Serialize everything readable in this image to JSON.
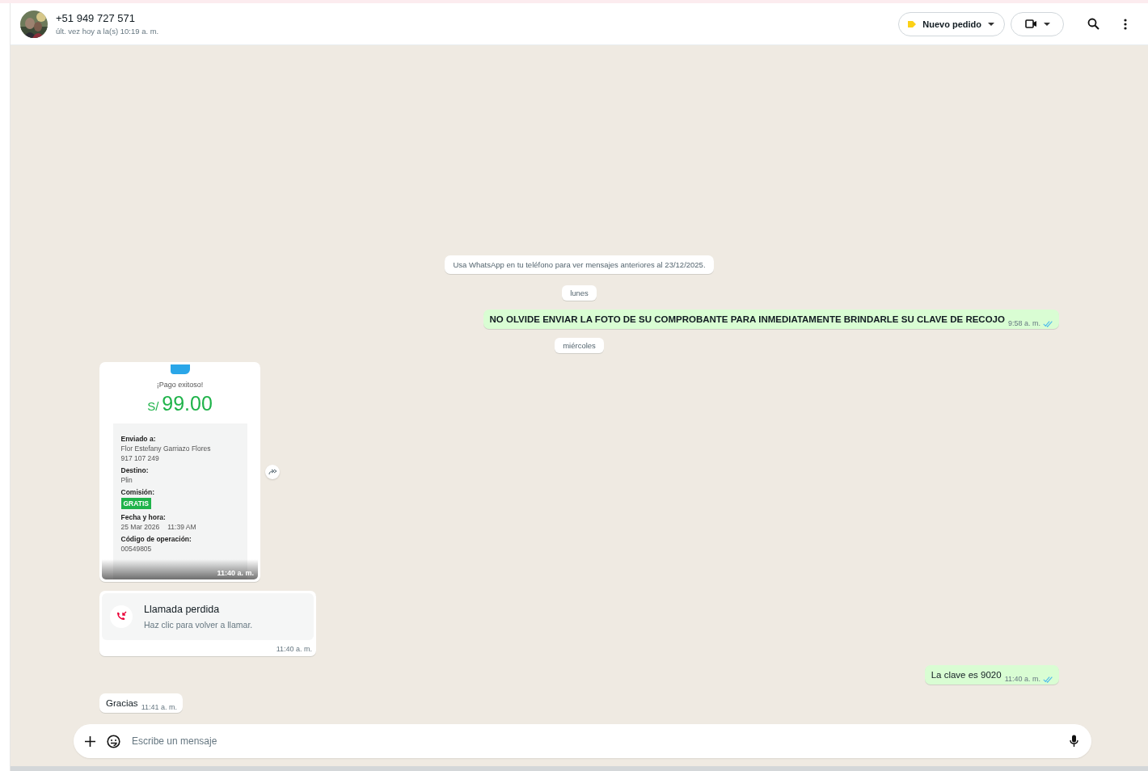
{
  "header": {
    "contact_name": "+51 949 727 571",
    "last_seen": "últ. vez hoy a la(s) 10:19 a. m.",
    "label_button": "Nuevo pedido"
  },
  "notice": "Usa WhatsApp en tu teléfono para ver mensajes anteriores al 23/12/2025.",
  "messages": [
    {
      "kind": "date",
      "text": "lunes"
    },
    {
      "kind": "outgoing",
      "text": "NO OLVIDE ENVIAR LA FOTO DE SU COMPROBANTE PARA INMEDIATAMENTE BRINDARLE SU CLAVE DE RECOJO",
      "bold": true,
      "time": "9:58 a. m.",
      "read": true
    },
    {
      "kind": "date",
      "text": "miércoles"
    },
    {
      "kind": "receipt",
      "title": "¡Pago exitoso!",
      "currency": "S/",
      "amount": "99.00",
      "time": "11:40 a. m.",
      "fields": [
        {
          "kind": "lines",
          "label": "Enviado a:",
          "values": [
            "Flor Estefany Garriazo Flores",
            "917 107 249"
          ]
        },
        {
          "kind": "lines",
          "label": "Destino:",
          "values": [
            "Plin"
          ]
        },
        {
          "kind": "badge",
          "label": "Comisión:",
          "values": [
            "GRATIS"
          ]
        },
        {
          "kind": "inline",
          "label": "Fecha y hora:",
          "values": [
            "25 Mar 2026",
            "11:39 AM"
          ]
        },
        {
          "kind": "lines",
          "label": "Código de operación:",
          "values": [
            "00549805"
          ]
        }
      ]
    },
    {
      "kind": "call",
      "title": "Llamada perdida",
      "subtitle": "Haz clic para volver a llamar.",
      "time": "11:40 a. m."
    },
    {
      "kind": "outgoing",
      "text": "La clave es 9020",
      "bold": false,
      "time": "11:40 a. m.",
      "read": true
    },
    {
      "kind": "incoming",
      "text": "Gracias",
      "time": "11:41 a. m."
    }
  ],
  "composer": {
    "placeholder": "Escribe un mensaje"
  }
}
